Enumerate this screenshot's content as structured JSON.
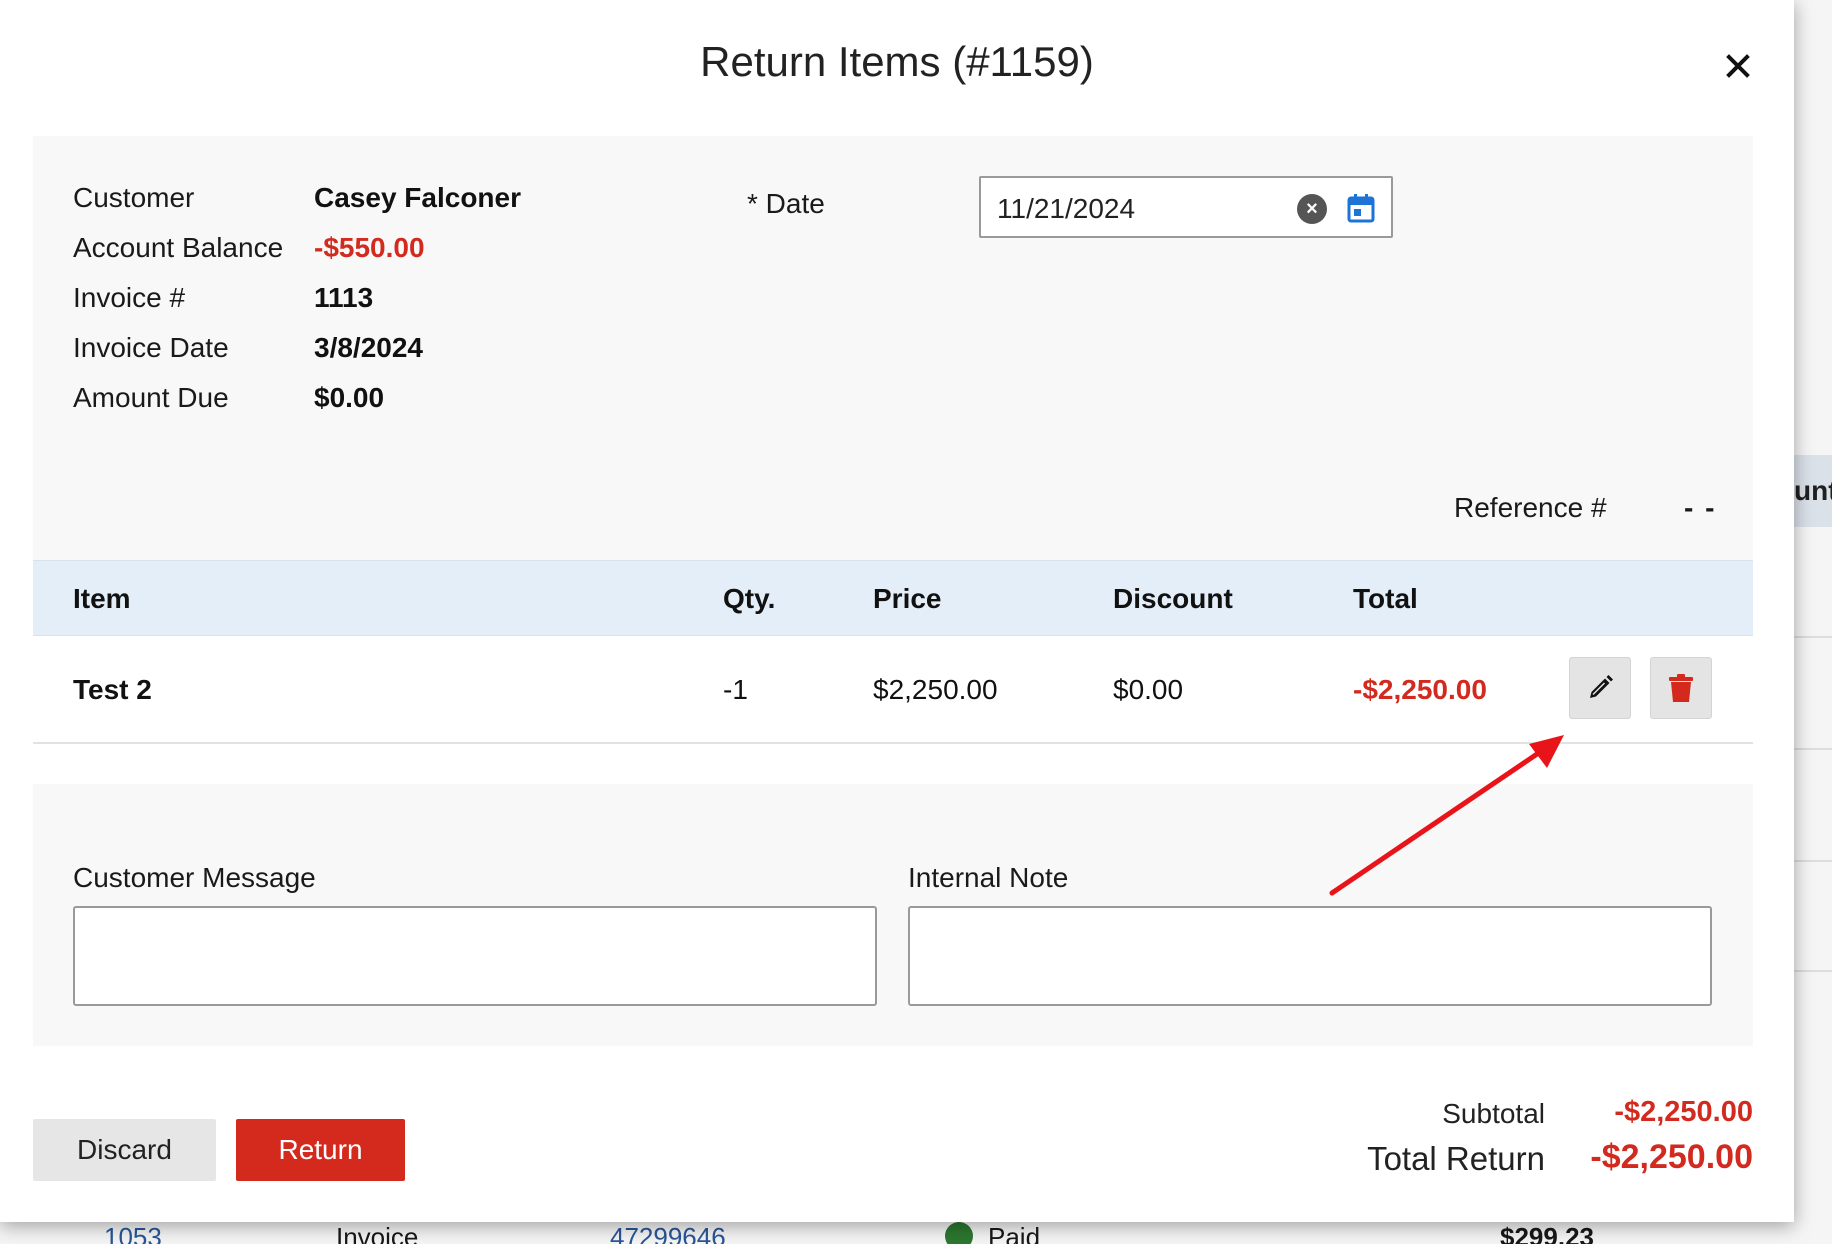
{
  "background": {
    "header_partial": "unt",
    "row": [
      "1053",
      "Invoice",
      "47299646",
      "Paid",
      "$299.23"
    ]
  },
  "modal": {
    "title": "Return Items (#1159)",
    "close_icon": "close-icon"
  },
  "info": {
    "customer_label": "Customer",
    "customer_value": "Casey Falconer",
    "balance_label": "Account Balance",
    "balance_value": "-$550.00",
    "invoice_label": "Invoice #",
    "invoice_value": "1113",
    "invoice_date_label": "Invoice Date",
    "invoice_date_value": "3/8/2024",
    "amount_due_label": "Amount Due",
    "amount_due_value": "$0.00",
    "date_label": "* Date",
    "date_value": "11/21/2024",
    "reference_label": "Reference #",
    "reference_value": "- -"
  },
  "table": {
    "headers": [
      "Item",
      "Qty.",
      "Price",
      "Discount",
      "Total"
    ],
    "rows": [
      {
        "item": "Test 2",
        "qty": "-1",
        "price": "$2,250.00",
        "discount": "$0.00",
        "total": "-$2,250.00"
      }
    ]
  },
  "notes": {
    "customer_message_label": "Customer Message",
    "internal_note_label": "Internal Note",
    "customer_message_value": "",
    "internal_note_value": ""
  },
  "footer": {
    "discard_label": "Discard",
    "return_label": "Return",
    "subtotal_label": "Subtotal",
    "subtotal_value": "-$2,250.00",
    "total_label": "Total Return",
    "total_value": "-$2,250.00"
  },
  "colors": {
    "accent_red": "#d42a1e",
    "header_blue": "#e4eef8",
    "annotation_arrow": "#e8141a"
  }
}
